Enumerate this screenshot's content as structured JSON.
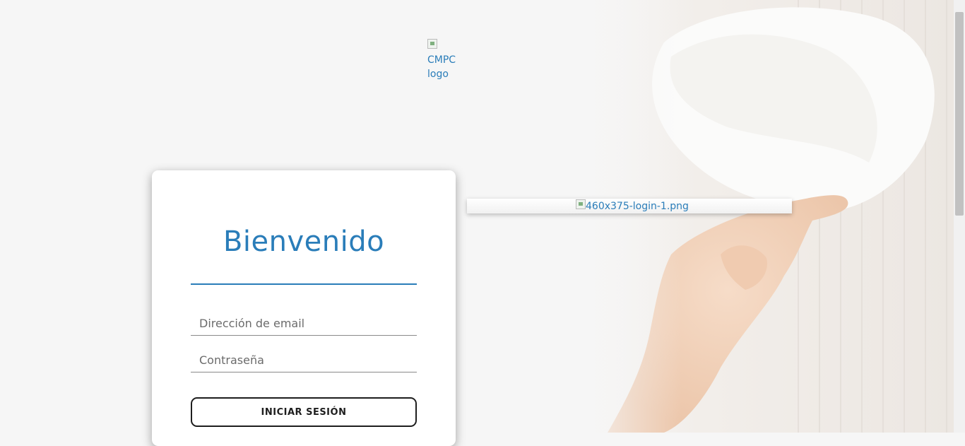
{
  "header": {
    "logo_alt": "CMPC logo"
  },
  "login": {
    "title": "Bienvenido",
    "email_placeholder": "Dirección de email",
    "password_placeholder": "Contraseña",
    "submit_label": "INICIAR SESIÓN"
  },
  "promo": {
    "image_alt": "460x375-login-1.png"
  },
  "colors": {
    "accent": "#2a7db9",
    "background": "#f6f6f6",
    "button_border": "#1e1e1e"
  },
  "icons": {
    "broken_image": "broken-image-icon"
  }
}
